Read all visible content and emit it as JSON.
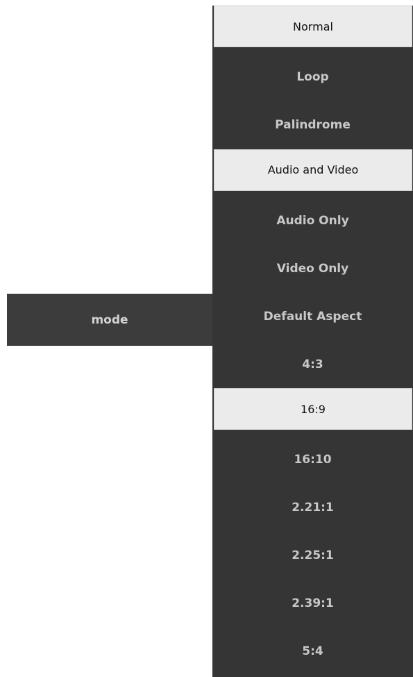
{
  "left_panel": {
    "mode_label": "mode"
  },
  "menu": {
    "items": [
      {
        "label": "Normal",
        "selected": true
      },
      {
        "label": "Loop",
        "selected": false
      },
      {
        "label": "Palindrome",
        "selected": false
      },
      {
        "label": "Audio and Video",
        "selected": true
      },
      {
        "label": "Audio Only",
        "selected": false
      },
      {
        "label": "Video Only",
        "selected": false
      },
      {
        "label": "Default Aspect",
        "selected": false
      },
      {
        "label": "4:3",
        "selected": false
      },
      {
        "label": "16:9",
        "selected": true
      },
      {
        "label": "16:10",
        "selected": false
      },
      {
        "label": "2.21:1",
        "selected": false
      },
      {
        "label": "2.25:1",
        "selected": false
      },
      {
        "label": "2.39:1",
        "selected": false
      },
      {
        "label": "5:4",
        "selected": false
      }
    ]
  },
  "colors": {
    "menu_background": "#353535",
    "mode_background": "#3c3c3c",
    "selected_background": "#ebebeb",
    "item_text": "#c8c8c8",
    "selected_text": "#111111"
  }
}
